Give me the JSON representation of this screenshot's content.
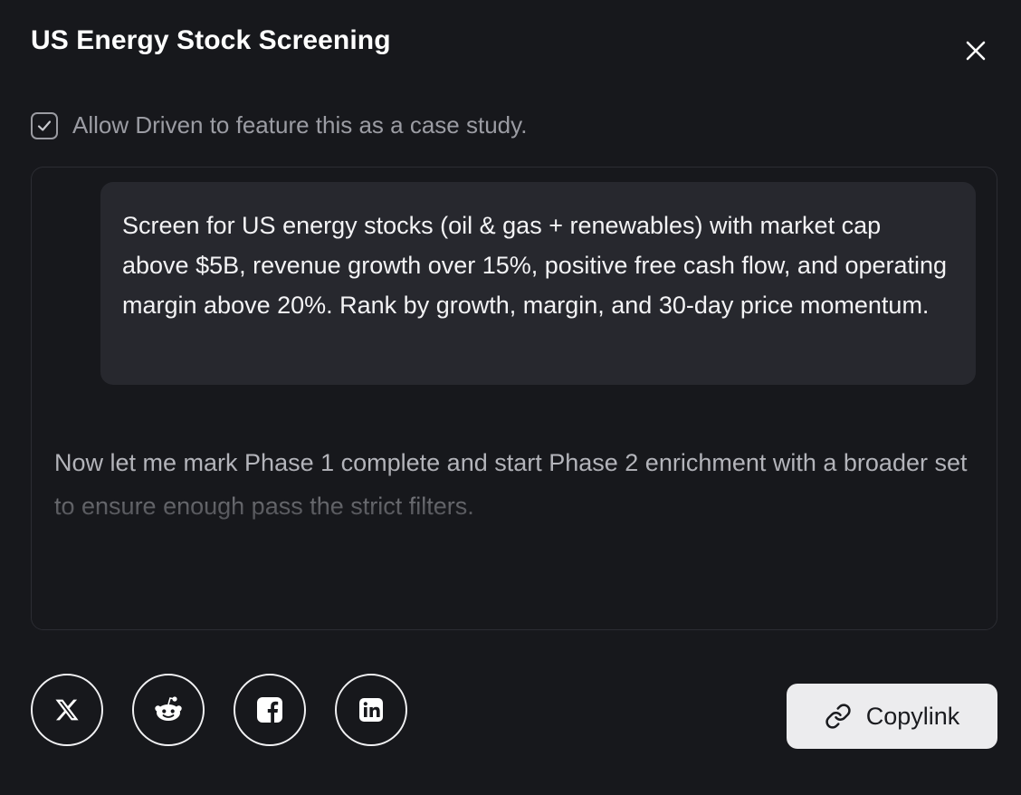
{
  "dialog": {
    "title": "US Energy Stock Screening",
    "close_icon": "close-icon"
  },
  "consent": {
    "checked": true,
    "label": "Allow Driven to feature this as a case study."
  },
  "transcript": {
    "user_message": "Screen for US energy stocks (oil & gas + renewables) with market cap above $5B, revenue growth over 15%, positive free cash flow, and operating margin above 20%. Rank by growth, margin, and 30-day price momentum.",
    "assistant_message": "Now let me mark Phase 1 complete and start Phase 2 enrichment with a broader set to ensure enough pass the strict filters."
  },
  "share": {
    "buttons": [
      {
        "icon": "x-twitter-icon"
      },
      {
        "icon": "reddit-icon"
      },
      {
        "icon": "facebook-icon"
      },
      {
        "icon": "linkedin-icon"
      }
    ],
    "copylink_label": "Copylink",
    "copylink_icon": "link-icon"
  },
  "colors": {
    "background": "#17181c",
    "bubble": "#27282e",
    "button_light": "#ececee"
  }
}
